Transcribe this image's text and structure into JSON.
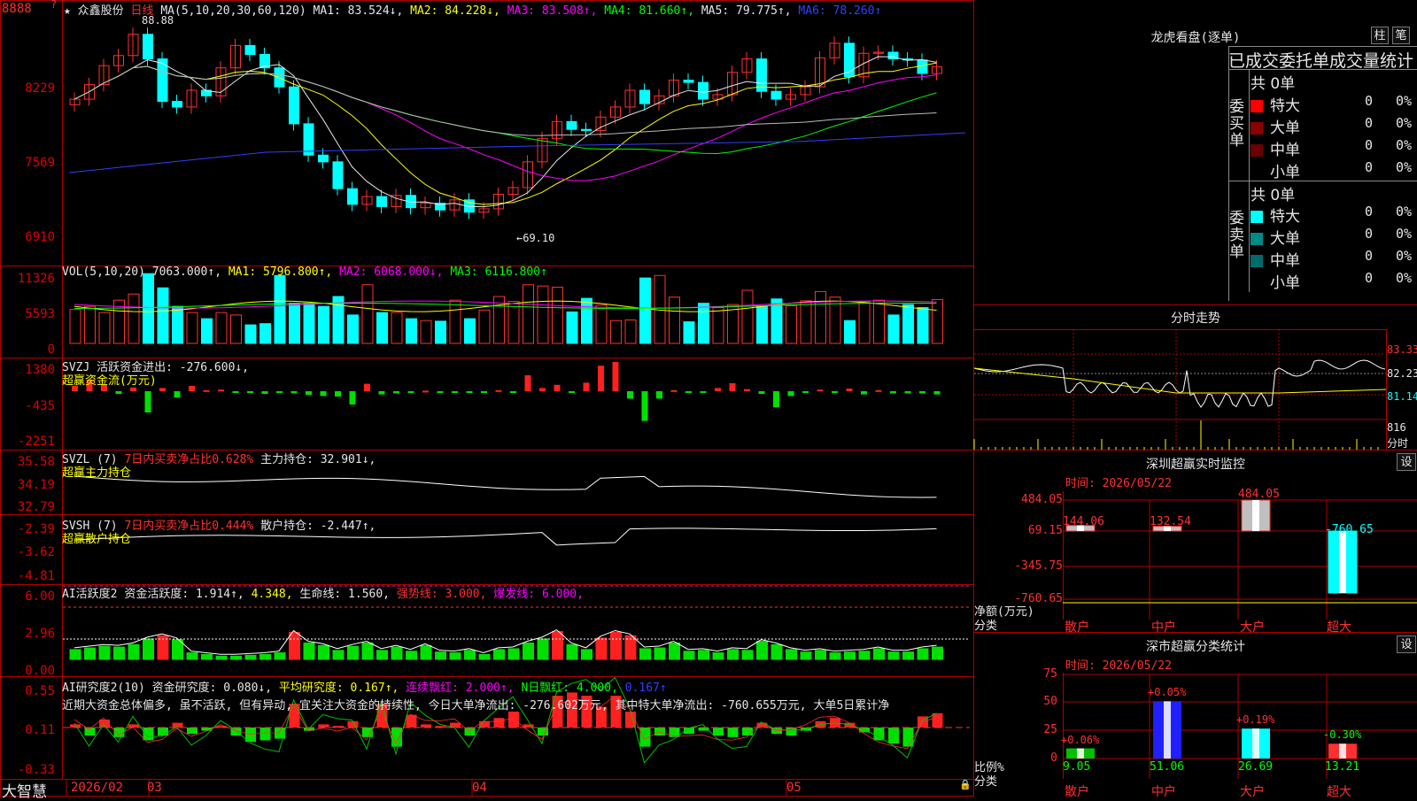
{
  "stock": {
    "name": "众鑫股份",
    "period": "日线",
    "star": "★"
  },
  "ma_legend": {
    "label": "MA(5,10,20,30,60,120)",
    "items": [
      {
        "text": "MA1: 83.524↓,",
        "color": "#e6e6e6"
      },
      {
        "text": "MA2: 84.228↓,",
        "color": "#ffff00"
      },
      {
        "text": "MA3: 83.508↑,",
        "color": "#ff00ff"
      },
      {
        "text": "MA4: 81.660↑,",
        "color": "#00ff00"
      },
      {
        "text": "MA5: 79.775↑,",
        "color": "#e6e6e6"
      },
      {
        "text": "MA6: 78.260↑",
        "color": "#3040ff"
      }
    ]
  },
  "price_axis": [
    "8888",
    "8229",
    "7569",
    "6910"
  ],
  "price_marks": {
    "high": "88.88",
    "low": "←69.10"
  },
  "vol_legend": {
    "label": "VOL(5,10,20)",
    "items": [
      {
        "text": "7063.000↑,",
        "color": "#e6e6e6"
      },
      {
        "text": "MA1: 5796.800↑,",
        "color": "#ffff00"
      },
      {
        "text": "MA2: 6068.000↓,",
        "color": "#ff00ff"
      },
      {
        "text": "MA3: 6116.800↑",
        "color": "#00ff00"
      }
    ]
  },
  "vol_axis": [
    "11326",
    "5593",
    "0"
  ],
  "svzj": {
    "label": "SVZJ",
    "text": "活跃资金进出: -276.600↓,",
    "sub": "超赢资金流(万元)",
    "axis": [
      "1380",
      "-435",
      "-2251"
    ]
  },
  "svzl": {
    "label": "SVZL (7)",
    "text1": "7日内买卖净占比0.628%",
    "text2": "主力持仓: 32.901↓,",
    "sub": "超赢主力持仓",
    "axis": [
      "35.58",
      "34.19",
      "32.79"
    ]
  },
  "svsh": {
    "label": "SVSH (7)",
    "text1": "7日内买卖净占比0.444%",
    "text2": "散户持仓: -2.447↑,",
    "sub": "超赢散户持仓",
    "axis": [
      "-2.39",
      "-3.62",
      "-4.81"
    ]
  },
  "ai_act": {
    "label": "AI活跃度2",
    "items": [
      {
        "text": "资金活跃度: 1.914↑,",
        "color": "#e6e6e6"
      },
      {
        "text": "4.348,",
        "color": "#ffff00"
      },
      {
        "text": "生命线: 1.560,",
        "color": "#e6e6e6"
      },
      {
        "text": "强势线: 3.000,",
        "color": "#ff3030"
      },
      {
        "text": "爆发线: 6.000,",
        "color": "#ff00ff"
      }
    ],
    "axis": [
      "6.00",
      "2.96",
      "0.00"
    ]
  },
  "ai_res": {
    "label": "AI研究度2(10)",
    "items": [
      {
        "text": "资金研究度: 0.080↓,",
        "color": "#e6e6e6"
      },
      {
        "text": "平均研究度: 0.167↑,",
        "color": "#ffff00"
      },
      {
        "text": "连续飘红: 2.000↑,",
        "color": "#ff00ff"
      },
      {
        "text": "N日飘红: 4.000,",
        "color": "#00ff00"
      },
      {
        "text": "0.167↑",
        "color": "#3040ff"
      }
    ],
    "comment": "近期大资金总体偏多, 虽不活跃, 但有异动, 宜关注大资金的持续性, 今日大单净流出: -276.602万元, 其中特大单净流出: -760.655万元, 大单5日累计净",
    "axis": [
      "0.55",
      "0.11",
      "-0.33"
    ]
  },
  "bottom_bar": {
    "brand": "大智慧",
    "dates": [
      "2026/02",
      "03",
      "04",
      "05"
    ]
  },
  "longhu": {
    "title": "龙虎看盘(逐单)",
    "tab1": "柱",
    "tab2": "笔",
    "header": "已成交委托单成交量统计",
    "buy": {
      "side_label": "委买单",
      "total": "共 0单",
      "rows": [
        {
          "name": "特大",
          "count": "0",
          "pct": "0%",
          "color": "#ff0000"
        },
        {
          "name": "大单",
          "count": "0",
          "pct": "0%",
          "color": "#8b0000"
        },
        {
          "name": "中单",
          "count": "0",
          "pct": "0%",
          "color": "#6b0000"
        },
        {
          "name": "小单",
          "count": "0",
          "pct": "0%",
          "color": "#000000"
        }
      ]
    },
    "sell": {
      "side_label": "委卖单",
      "total": "共 0单",
      "rows": [
        {
          "name": "特大",
          "count": "0",
          "pct": "0%",
          "color": "#00ffff"
        },
        {
          "name": "大单",
          "count": "0",
          "pct": "0%",
          "color": "#008b8b"
        },
        {
          "name": "中单",
          "count": "0",
          "pct": "0%",
          "color": "#006b6b"
        },
        {
          "name": "小单",
          "count": "0",
          "pct": "0%",
          "color": "#000000"
        }
      ]
    }
  },
  "fenshi": {
    "title": "分时走势",
    "axis": [
      "83.33",
      "82.23",
      "81.14",
      "816",
      "分时"
    ]
  },
  "sz_monitor": {
    "title": "深圳超赢实时监控",
    "setting": "设",
    "time": "时间: 2026/05/22",
    "axis": [
      "484.05",
      "69.15",
      "-345.75",
      "-760.65"
    ],
    "axis_caption": "净额(万元)",
    "axis_caption2": "分类",
    "categories": [
      "散户",
      "中户",
      "大户",
      "超大"
    ],
    "values": [
      "144.06",
      "132.54",
      "484.05",
      "-760.65"
    ]
  },
  "sz_class": {
    "title": "深市超赢分类统计",
    "setting": "设",
    "time": "时间: 2026/05/22",
    "axis": [
      "75",
      "50",
      "25",
      "0"
    ],
    "axis_caption": "比例%",
    "axis_caption2": "分类",
    "categories": [
      "散户",
      "中户",
      "大户",
      "超大"
    ],
    "values": [
      "9.05",
      "51.06",
      "26.69",
      "13.21"
    ],
    "changes": [
      "+0.06%",
      "+0.05%",
      "+0.19%",
      "-0.30%"
    ]
  }
}
